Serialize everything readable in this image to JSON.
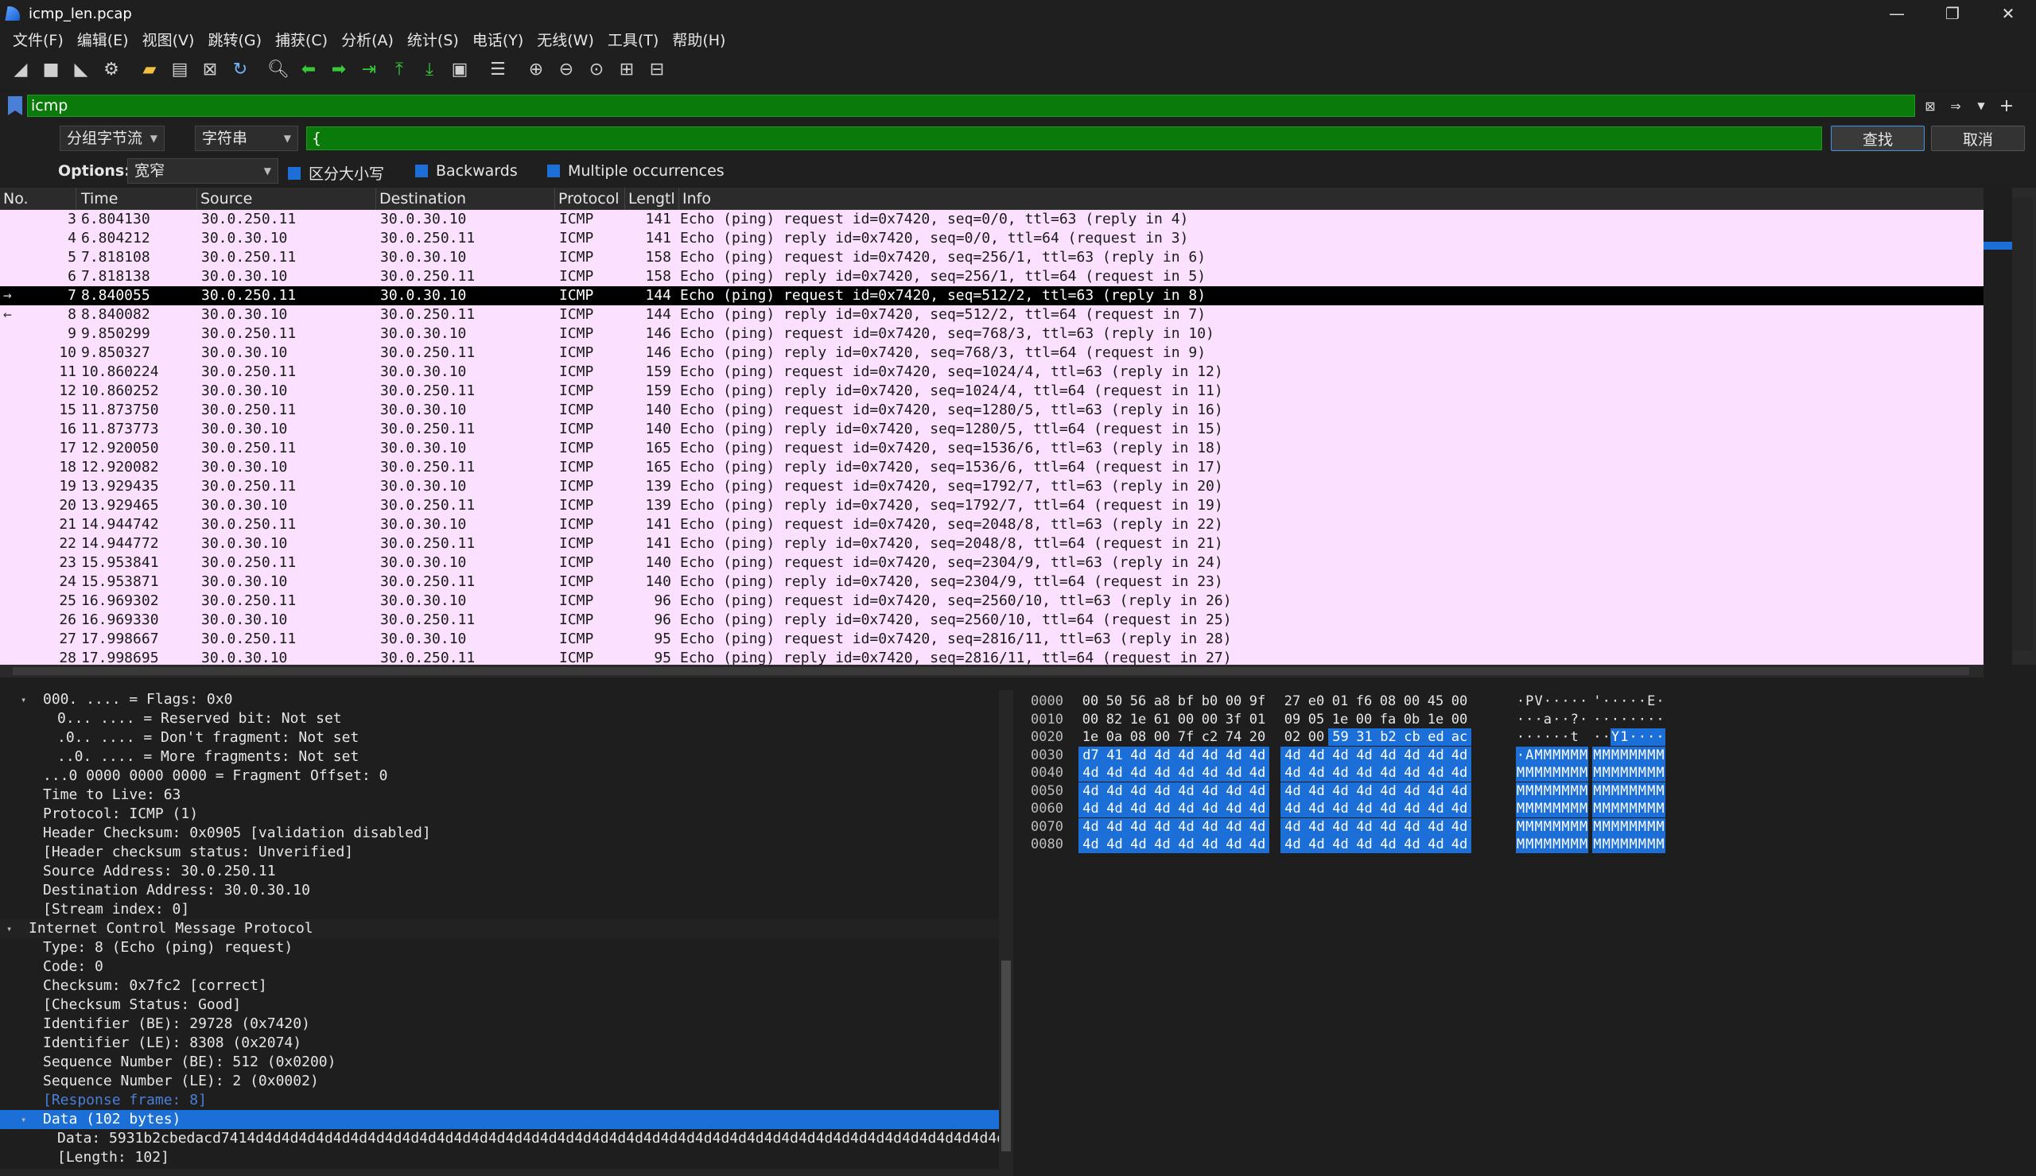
{
  "window": {
    "title": "icmp_len.pcap",
    "minimize": "—",
    "restore": "❐",
    "close": "✕"
  },
  "menu": [
    "文件(F)",
    "编辑(E)",
    "视图(V)",
    "跳转(G)",
    "捕获(C)",
    "分析(A)",
    "统计(S)",
    "电话(Y)",
    "无线(W)",
    "工具(T)",
    "帮助(H)"
  ],
  "filter": {
    "value": "icmp",
    "plus": "+"
  },
  "find": {
    "scope": "分组字节流",
    "type": "字符串",
    "value": "{",
    "find_button": "查找",
    "cancel_button": "取消"
  },
  "options": {
    "label": "Options:",
    "charset": "宽窄",
    "case": "区分大小写",
    "backwards": "Backwards",
    "multiple": "Multiple occurrences"
  },
  "colors": {
    "row_bg": "#fce0ff",
    "selected_bg": "#000000",
    "filter_green": "#0a7a0a",
    "highlight_blue": "#1b6fd6"
  },
  "packet_list": {
    "columns": [
      "No.",
      "Time",
      "Source",
      "Destination",
      "Protocol",
      "Lengtl",
      "Info"
    ],
    "rows": [
      {
        "no": "3",
        "time": "6.804130",
        "src": "30.0.250.11",
        "dst": "30.0.30.10",
        "proto": "ICMP",
        "len": "141",
        "info": "Echo (ping) request  id=0x7420, seq=0/0, ttl=63 (reply in 4)",
        "mark": ""
      },
      {
        "no": "4",
        "time": "6.804212",
        "src": "30.0.30.10",
        "dst": "30.0.250.11",
        "proto": "ICMP",
        "len": "141",
        "info": "Echo (ping) reply    id=0x7420, seq=0/0, ttl=64 (request in 3)",
        "mark": ""
      },
      {
        "no": "5",
        "time": "7.818108",
        "src": "30.0.250.11",
        "dst": "30.0.30.10",
        "proto": "ICMP",
        "len": "158",
        "info": "Echo (ping) request  id=0x7420, seq=256/1, ttl=63 (reply in 6)",
        "mark": ""
      },
      {
        "no": "6",
        "time": "7.818138",
        "src": "30.0.30.10",
        "dst": "30.0.250.11",
        "proto": "ICMP",
        "len": "158",
        "info": "Echo (ping) reply    id=0x7420, seq=256/1, ttl=64 (request in 5)",
        "mark": ""
      },
      {
        "no": "7",
        "time": "8.840055",
        "src": "30.0.250.11",
        "dst": "30.0.30.10",
        "proto": "ICMP",
        "len": "144",
        "info": "Echo (ping) request  id=0x7420, seq=512/2, ttl=63 (reply in 8)",
        "mark": "→",
        "selected": true
      },
      {
        "no": "8",
        "time": "8.840082",
        "src": "30.0.30.10",
        "dst": "30.0.250.11",
        "proto": "ICMP",
        "len": "144",
        "info": "Echo (ping) reply    id=0x7420, seq=512/2, ttl=64 (request in 7)",
        "mark": "←"
      },
      {
        "no": "9",
        "time": "9.850299",
        "src": "30.0.250.11",
        "dst": "30.0.30.10",
        "proto": "ICMP",
        "len": "146",
        "info": "Echo (ping) request  id=0x7420, seq=768/3, ttl=63 (reply in 10)",
        "mark": ""
      },
      {
        "no": "10",
        "time": "9.850327",
        "src": "30.0.30.10",
        "dst": "30.0.250.11",
        "proto": "ICMP",
        "len": "146",
        "info": "Echo (ping) reply    id=0x7420, seq=768/3, ttl=64 (request in 9)",
        "mark": ""
      },
      {
        "no": "11",
        "time": "10.860224",
        "src": "30.0.250.11",
        "dst": "30.0.30.10",
        "proto": "ICMP",
        "len": "159",
        "info": "Echo (ping) request  id=0x7420, seq=1024/4, ttl=63 (reply in 12)",
        "mark": ""
      },
      {
        "no": "12",
        "time": "10.860252",
        "src": "30.0.30.10",
        "dst": "30.0.250.11",
        "proto": "ICMP",
        "len": "159",
        "info": "Echo (ping) reply    id=0x7420, seq=1024/4, ttl=64 (request in 11)",
        "mark": ""
      },
      {
        "no": "15",
        "time": "11.873750",
        "src": "30.0.250.11",
        "dst": "30.0.30.10",
        "proto": "ICMP",
        "len": "140",
        "info": "Echo (ping) request  id=0x7420, seq=1280/5, ttl=63 (reply in 16)",
        "mark": ""
      },
      {
        "no": "16",
        "time": "11.873773",
        "src": "30.0.30.10",
        "dst": "30.0.250.11",
        "proto": "ICMP",
        "len": "140",
        "info": "Echo (ping) reply    id=0x7420, seq=1280/5, ttl=64 (request in 15)",
        "mark": ""
      },
      {
        "no": "17",
        "time": "12.920050",
        "src": "30.0.250.11",
        "dst": "30.0.30.10",
        "proto": "ICMP",
        "len": "165",
        "info": "Echo (ping) request  id=0x7420, seq=1536/6, ttl=63 (reply in 18)",
        "mark": ""
      },
      {
        "no": "18",
        "time": "12.920082",
        "src": "30.0.30.10",
        "dst": "30.0.250.11",
        "proto": "ICMP",
        "len": "165",
        "info": "Echo (ping) reply    id=0x7420, seq=1536/6, ttl=64 (request in 17)",
        "mark": ""
      },
      {
        "no": "19",
        "time": "13.929435",
        "src": "30.0.250.11",
        "dst": "30.0.30.10",
        "proto": "ICMP",
        "len": "139",
        "info": "Echo (ping) request  id=0x7420, seq=1792/7, ttl=63 (reply in 20)",
        "mark": ""
      },
      {
        "no": "20",
        "time": "13.929465",
        "src": "30.0.30.10",
        "dst": "30.0.250.11",
        "proto": "ICMP",
        "len": "139",
        "info": "Echo (ping) reply    id=0x7420, seq=1792/7, ttl=64 (request in 19)",
        "mark": ""
      },
      {
        "no": "21",
        "time": "14.944742",
        "src": "30.0.250.11",
        "dst": "30.0.30.10",
        "proto": "ICMP",
        "len": "141",
        "info": "Echo (ping) request  id=0x7420, seq=2048/8, ttl=63 (reply in 22)",
        "mark": ""
      },
      {
        "no": "22",
        "time": "14.944772",
        "src": "30.0.30.10",
        "dst": "30.0.250.11",
        "proto": "ICMP",
        "len": "141",
        "info": "Echo (ping) reply    id=0x7420, seq=2048/8, ttl=64 (request in 21)",
        "mark": ""
      },
      {
        "no": "23",
        "time": "15.953841",
        "src": "30.0.250.11",
        "dst": "30.0.30.10",
        "proto": "ICMP",
        "len": "140",
        "info": "Echo (ping) request  id=0x7420, seq=2304/9, ttl=63 (reply in 24)",
        "mark": ""
      },
      {
        "no": "24",
        "time": "15.953871",
        "src": "30.0.30.10",
        "dst": "30.0.250.11",
        "proto": "ICMP",
        "len": "140",
        "info": "Echo (ping) reply    id=0x7420, seq=2304/9, ttl=64 (request in 23)",
        "mark": ""
      },
      {
        "no": "25",
        "time": "16.969302",
        "src": "30.0.250.11",
        "dst": "30.0.30.10",
        "proto": "ICMP",
        "len": "96",
        "info": "Echo (ping) request  id=0x7420, seq=2560/10, ttl=63 (reply in 26)",
        "mark": ""
      },
      {
        "no": "26",
        "time": "16.969330",
        "src": "30.0.30.10",
        "dst": "30.0.250.11",
        "proto": "ICMP",
        "len": "96",
        "info": "Echo (ping) reply    id=0x7420, seq=2560/10, ttl=64 (request in 25)",
        "mark": ""
      },
      {
        "no": "27",
        "time": "17.998667",
        "src": "30.0.250.11",
        "dst": "30.0.30.10",
        "proto": "ICMP",
        "len": "95",
        "info": "Echo (ping) request  id=0x7420, seq=2816/11, ttl=63 (reply in 28)",
        "mark": ""
      },
      {
        "no": "28",
        "time": "17.998695",
        "src": "30.0.30.10",
        "dst": "30.0.250.11",
        "proto": "ICMP",
        "len": "95",
        "info": "Echo (ping) reply    id=0x7420, seq=2816/11, ttl=64 (request in 27)",
        "mark": ""
      }
    ]
  },
  "details": [
    {
      "text": "000. .... = Flags: 0x0",
      "indent": 2,
      "toggle": "▾"
    },
    {
      "text": "0... .... = Reserved bit: Not set",
      "indent": 3
    },
    {
      "text": ".0.. .... = Don't fragment: Not set",
      "indent": 3
    },
    {
      "text": "..0. .... = More fragments: Not set",
      "indent": 3
    },
    {
      "text": "...0 0000 0000 0000 = Fragment Offset: 0",
      "indent": 2
    },
    {
      "text": "Time to Live: 63",
      "indent": 2
    },
    {
      "text": "Protocol: ICMP (1)",
      "indent": 2
    },
    {
      "text": "Header Checksum: 0x0905 [validation disabled]",
      "indent": 2
    },
    {
      "text": "[Header checksum status: Unverified]",
      "indent": 2
    },
    {
      "text": "Source Address: 30.0.250.11",
      "indent": 2
    },
    {
      "text": "Destination Address: 30.0.30.10",
      "indent": 2
    },
    {
      "text": "[Stream index: 0]",
      "indent": 2
    },
    {
      "text": "Internet Control Message Protocol",
      "indent": 1,
      "toggle": "▾",
      "section": true
    },
    {
      "text": "Type: 8 (Echo (ping) request)",
      "indent": 2
    },
    {
      "text": "Code: 0",
      "indent": 2
    },
    {
      "text": "Checksum: 0x7fc2 [correct]",
      "indent": 2
    },
    {
      "text": "[Checksum Status: Good]",
      "indent": 2
    },
    {
      "text": "Identifier (BE): 29728 (0x7420)",
      "indent": 2
    },
    {
      "text": "Identifier (LE): 8308 (0x2074)",
      "indent": 2
    },
    {
      "text": "Sequence Number (BE): 512 (0x0200)",
      "indent": 2
    },
    {
      "text": "Sequence Number (LE): 2 (0x0002)",
      "indent": 2
    },
    {
      "text": "[Response frame: 8]",
      "indent": 2,
      "link": true
    },
    {
      "text": "Data (102 bytes)",
      "indent": 2,
      "toggle": "▾",
      "highlight": true
    },
    {
      "text": "Data: 5931b2cbedacd7414d4d4d4d4d4d4d4d4d4d4d4d4d4d4d4d4d4d4d4d4d4d4d4d4d4d4d4d4d4d4d4d4d4d4d4d4d4d4d4d4d4d4d4d4d4d4d4d4d4d4d4",
      "indent": 3
    },
    {
      "text": "[Length: 102]",
      "indent": 3
    }
  ],
  "bytes": [
    {
      "offset": "0000",
      "hex": [
        "00",
        "50",
        "56",
        "a8",
        "bf",
        "b0",
        "00",
        "9f",
        "27",
        "e0",
        "01",
        "f6",
        "08",
        "00",
        "45",
        "00"
      ],
      "ascii": "·PV·····'·····E·",
      "hl_from": 99
    },
    {
      "offset": "0010",
      "hex": [
        "00",
        "82",
        "1e",
        "61",
        "00",
        "00",
        "3f",
        "01",
        "09",
        "05",
        "1e",
        "00",
        "fa",
        "0b",
        "1e",
        "00"
      ],
      "ascii": "···a··?·········",
      "hl_from": 99
    },
    {
      "offset": "0020",
      "hex": [
        "1e",
        "0a",
        "08",
        "00",
        "7f",
        "c2",
        "74",
        "20",
        "02",
        "00",
        "59",
        "31",
        "b2",
        "cb",
        "ed",
        "ac"
      ],
      "ascii": "······t ··Y1····",
      "hl_from": 10
    },
    {
      "offset": "0030",
      "hex": [
        "d7",
        "41",
        "4d",
        "4d",
        "4d",
        "4d",
        "4d",
        "4d",
        "4d",
        "4d",
        "4d",
        "4d",
        "4d",
        "4d",
        "4d",
        "4d"
      ],
      "ascii": "·AMMMMMMMMMMMMMM",
      "hl_from": 0
    },
    {
      "offset": "0040",
      "hex": [
        "4d",
        "4d",
        "4d",
        "4d",
        "4d",
        "4d",
        "4d",
        "4d",
        "4d",
        "4d",
        "4d",
        "4d",
        "4d",
        "4d",
        "4d",
        "4d"
      ],
      "ascii": "MMMMMMMMMMMMMMMM",
      "hl_from": 0
    },
    {
      "offset": "0050",
      "hex": [
        "4d",
        "4d",
        "4d",
        "4d",
        "4d",
        "4d",
        "4d",
        "4d",
        "4d",
        "4d",
        "4d",
        "4d",
        "4d",
        "4d",
        "4d",
        "4d"
      ],
      "ascii": "MMMMMMMMMMMMMMMM",
      "hl_from": 0
    },
    {
      "offset": "0060",
      "hex": [
        "4d",
        "4d",
        "4d",
        "4d",
        "4d",
        "4d",
        "4d",
        "4d",
        "4d",
        "4d",
        "4d",
        "4d",
        "4d",
        "4d",
        "4d",
        "4d"
      ],
      "ascii": "MMMMMMMMMMMMMMMM",
      "hl_from": 0
    },
    {
      "offset": "0070",
      "hex": [
        "4d",
        "4d",
        "4d",
        "4d",
        "4d",
        "4d",
        "4d",
        "4d",
        "4d",
        "4d",
        "4d",
        "4d",
        "4d",
        "4d",
        "4d",
        "4d"
      ],
      "ascii": "MMMMMMMMMMMMMMMM",
      "hl_from": 0
    },
    {
      "offset": "0080",
      "hex": [
        "4d",
        "4d",
        "4d",
        "4d",
        "4d",
        "4d",
        "4d",
        "4d",
        "4d",
        "4d",
        "4d",
        "4d",
        "4d",
        "4d",
        "4d",
        "4d"
      ],
      "ascii": "MMMMMMMMMMMMMMMM",
      "hl_from": 0
    }
  ]
}
